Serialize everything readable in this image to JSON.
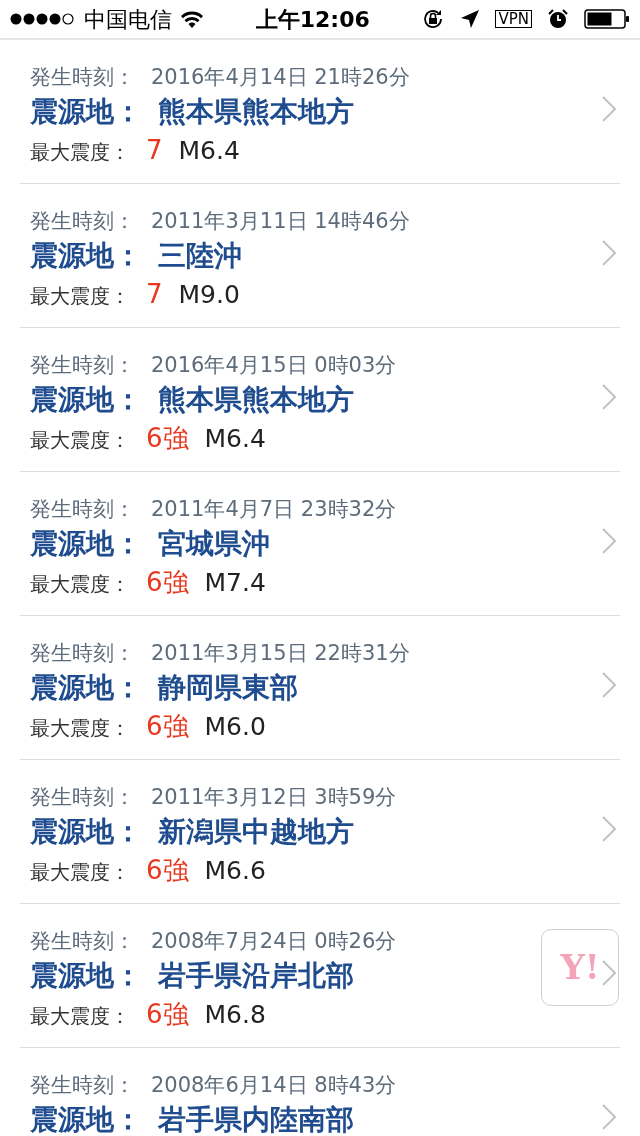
{
  "status_bar": {
    "carrier": "中国电信",
    "time": "上午12:06",
    "vpn": "VPN"
  },
  "quakes": [
    {
      "time_label": "発生時刻：",
      "time": "2016年4月14日 21時26分",
      "place_label": "震源地：",
      "place": "熊本県熊本地方",
      "intensity_label": "最大震度：",
      "intensity": "7",
      "magnitude": "M6.4"
    },
    {
      "time_label": "発生時刻：",
      "time": "2011年3月11日 14時46分",
      "place_label": "震源地：",
      "place": "三陸沖",
      "intensity_label": "最大震度：",
      "intensity": "7",
      "magnitude": "M9.0"
    },
    {
      "time_label": "発生時刻：",
      "time": "2016年4月15日 0時03分",
      "place_label": "震源地：",
      "place": "熊本県熊本地方",
      "intensity_label": "最大震度：",
      "intensity": "6強",
      "magnitude": "M6.4"
    },
    {
      "time_label": "発生時刻：",
      "time": "2011年4月7日 23時32分",
      "place_label": "震源地：",
      "place": "宮城県沖",
      "intensity_label": "最大震度：",
      "intensity": "6強",
      "magnitude": "M7.4"
    },
    {
      "time_label": "発生時刻：",
      "time": "2011年3月15日 22時31分",
      "place_label": "震源地：",
      "place": "静岡県東部",
      "intensity_label": "最大震度：",
      "intensity": "6強",
      "magnitude": "M6.0"
    },
    {
      "time_label": "発生時刻：",
      "time": "2011年3月12日 3時59分",
      "place_label": "震源地：",
      "place": "新潟県中越地方",
      "intensity_label": "最大震度：",
      "intensity": "6強",
      "magnitude": "M6.6"
    },
    {
      "time_label": "発生時刻：",
      "time": "2008年7月24日 0時26分",
      "place_label": "震源地：",
      "place": "岩手県沿岸北部",
      "intensity_label": "最大震度：",
      "intensity": "6強",
      "magnitude": "M6.8"
    },
    {
      "time_label": "発生時刻：",
      "time": "2008年6月14日 8時43分",
      "place_label": "震源地：",
      "place": "岩手県内陸南部"
    }
  ],
  "floating_button": {
    "label": "Y!"
  }
}
